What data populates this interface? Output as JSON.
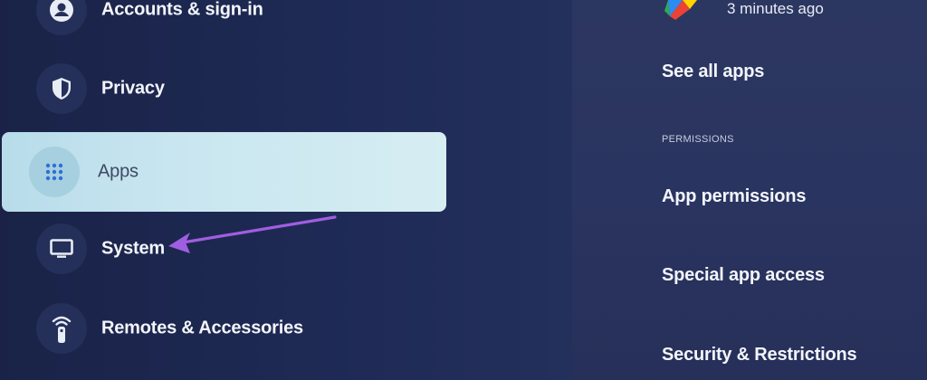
{
  "left_menu": {
    "items": [
      {
        "label": "Accounts & sign-in",
        "icon": "account-circle-icon"
      },
      {
        "label": "Privacy",
        "icon": "shield-icon"
      },
      {
        "label": "Apps",
        "icon": "apps-grid-icon",
        "selected": true
      },
      {
        "label": "System",
        "icon": "tv-icon"
      },
      {
        "label": "Remotes & Accessories",
        "icon": "remote-icon"
      }
    ]
  },
  "right_panel": {
    "recent_app_time": "3 minutes ago",
    "see_all_apps": "See all apps",
    "section_permissions": "PERMISSIONS",
    "app_permissions": "App permissions",
    "special_app_access": "Special app access",
    "security_restrictions": "Security & Restrictions"
  },
  "colors": {
    "background": "#1e2a55",
    "selected_item": "#c9e6f0",
    "annotation_arrow": "#a05ee0"
  }
}
